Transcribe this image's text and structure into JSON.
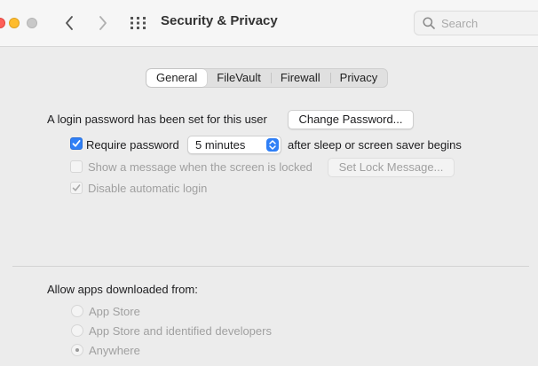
{
  "window": {
    "title": "Security & Privacy",
    "search_placeholder": "Search"
  },
  "toolbar": {
    "back_icon": "chevron-left-icon",
    "forward_icon": "chevron-right-icon",
    "grid_icon": "grid-icon"
  },
  "tabs": [
    {
      "label": "General",
      "active": true
    },
    {
      "label": "FileVault",
      "active": false
    },
    {
      "label": "Firewall",
      "active": false
    },
    {
      "label": "Privacy",
      "active": false
    }
  ],
  "general": {
    "login_text": "A login password has been set for this user",
    "change_password_button": "Change Password...",
    "require_password": {
      "label": "Require password",
      "checked": true
    },
    "require_interval": {
      "value": "5 minutes"
    },
    "require_suffix": "after sleep or screen saver begins",
    "show_message": {
      "label": "Show a message when the screen is locked",
      "checked": false,
      "enabled": false
    },
    "set_lock_message_button": "Set Lock Message...",
    "disable_auto_login": {
      "label": "Disable automatic login",
      "checked": true,
      "enabled": false
    }
  },
  "downloads": {
    "heading": "Allow apps downloaded from:",
    "options": [
      {
        "label": "App Store",
        "selected": false
      },
      {
        "label": "App Store and identified developers",
        "selected": false
      },
      {
        "label": "Anywhere",
        "selected": true
      }
    ]
  },
  "colors": {
    "accent": "#2f7ff6",
    "close": "#fe5f57",
    "minimize": "#febc2e"
  }
}
